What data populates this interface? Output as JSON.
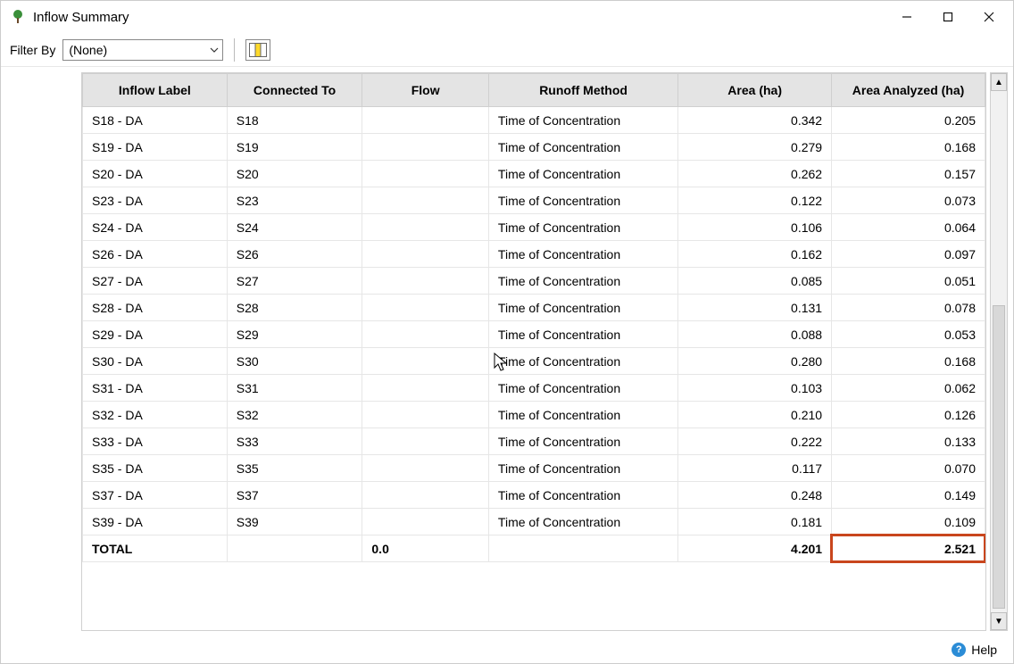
{
  "window": {
    "title": "Inflow Summary"
  },
  "toolbar": {
    "filter_label": "Filter By",
    "filter_value": "(None)"
  },
  "table": {
    "headers": {
      "inflow_label": "Inflow Label",
      "connected_to": "Connected To",
      "flow": "Flow",
      "runoff_method": "Runoff Method",
      "area": "Area (ha)",
      "area_analyzed": "Area Analyzed (ha)"
    },
    "rows": [
      {
        "label": "S18 - DA",
        "connected": "S18",
        "flow": "",
        "method": "Time of Concentration",
        "area": "0.342",
        "area_an": "0.205"
      },
      {
        "label": "S19 - DA",
        "connected": "S19",
        "flow": "",
        "method": "Time of Concentration",
        "area": "0.279",
        "area_an": "0.168"
      },
      {
        "label": "S20 - DA",
        "connected": "S20",
        "flow": "",
        "method": "Time of Concentration",
        "area": "0.262",
        "area_an": "0.157"
      },
      {
        "label": "S23 - DA",
        "connected": "S23",
        "flow": "",
        "method": "Time of Concentration",
        "area": "0.122",
        "area_an": "0.073"
      },
      {
        "label": "S24 - DA",
        "connected": "S24",
        "flow": "",
        "method": "Time of Concentration",
        "area": "0.106",
        "area_an": "0.064"
      },
      {
        "label": "S26 - DA",
        "connected": "S26",
        "flow": "",
        "method": "Time of Concentration",
        "area": "0.162",
        "area_an": "0.097"
      },
      {
        "label": "S27 - DA",
        "connected": "S27",
        "flow": "",
        "method": "Time of Concentration",
        "area": "0.085",
        "area_an": "0.051"
      },
      {
        "label": "S28 - DA",
        "connected": "S28",
        "flow": "",
        "method": "Time of Concentration",
        "area": "0.131",
        "area_an": "0.078"
      },
      {
        "label": "S29 - DA",
        "connected": "S29",
        "flow": "",
        "method": "Time of Concentration",
        "area": "0.088",
        "area_an": "0.053"
      },
      {
        "label": "S30 - DA",
        "connected": "S30",
        "flow": "",
        "method": "Time of Concentration",
        "area": "0.280",
        "area_an": "0.168"
      },
      {
        "label": "S31 - DA",
        "connected": "S31",
        "flow": "",
        "method": "Time of Concentration",
        "area": "0.103",
        "area_an": "0.062"
      },
      {
        "label": "S32 - DA",
        "connected": "S32",
        "flow": "",
        "method": "Time of Concentration",
        "area": "0.210",
        "area_an": "0.126"
      },
      {
        "label": "S33 - DA",
        "connected": "S33",
        "flow": "",
        "method": "Time of Concentration",
        "area": "0.222",
        "area_an": "0.133"
      },
      {
        "label": "S35 - DA",
        "connected": "S35",
        "flow": "",
        "method": "Time of Concentration",
        "area": "0.117",
        "area_an": "0.070"
      },
      {
        "label": "S37 - DA",
        "connected": "S37",
        "flow": "",
        "method": "Time of Concentration",
        "area": "0.248",
        "area_an": "0.149"
      },
      {
        "label": "S39 - DA",
        "connected": "S39",
        "flow": "",
        "method": "Time of Concentration",
        "area": "0.181",
        "area_an": "0.109"
      }
    ],
    "total": {
      "label": "TOTAL",
      "flow": "0.0",
      "area": "4.201",
      "area_an": "2.521"
    }
  },
  "footer": {
    "help_label": "Help"
  }
}
